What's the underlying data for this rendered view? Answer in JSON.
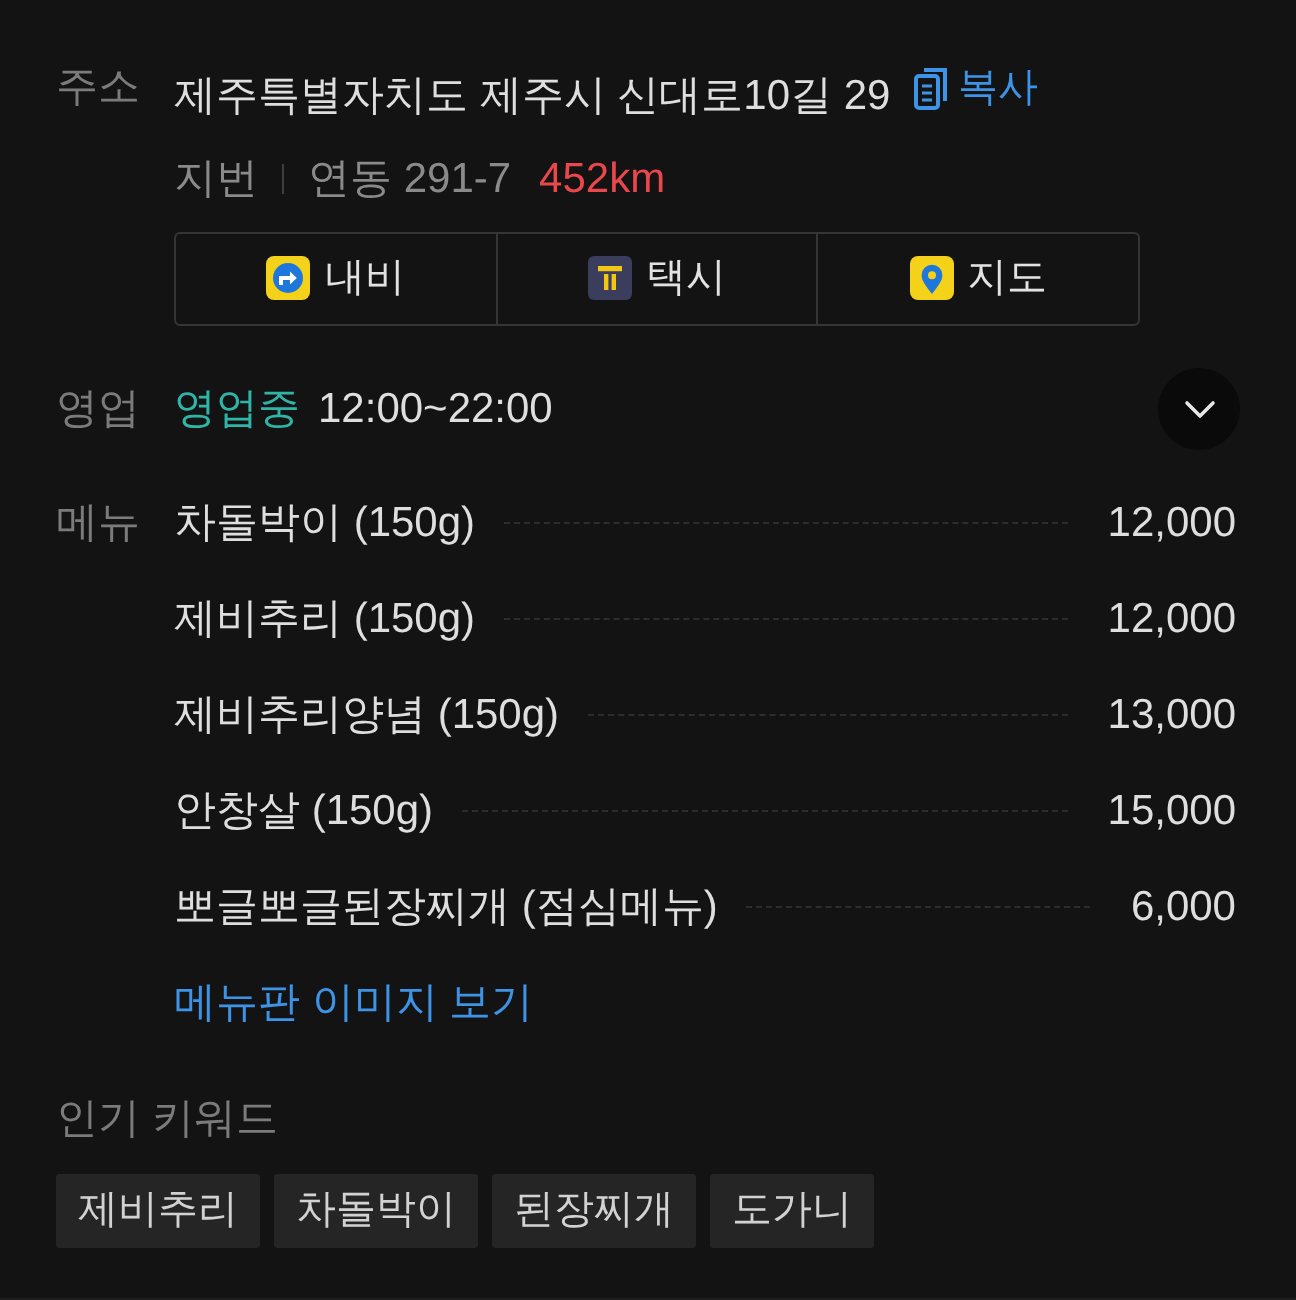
{
  "address": {
    "label": "주소",
    "road": "제주특별자치도 제주시 신대로10길 29",
    "copy_button": "복사",
    "lot_label": "지번",
    "lot": "연동 291-7",
    "distance": "452km"
  },
  "actions": [
    {
      "kind": "navi",
      "label": "내비"
    },
    {
      "kind": "taxi",
      "label": "택시"
    },
    {
      "kind": "map",
      "label": "지도"
    }
  ],
  "hours": {
    "label": "영업",
    "status": "영업중",
    "time": "12:00~22:00",
    "expanded": false
  },
  "menu": {
    "label": "메뉴",
    "items": [
      {
        "name": "차돌박이 (150g)",
        "price": "12,000"
      },
      {
        "name": "제비추리 (150g)",
        "price": "12,000"
      },
      {
        "name": "제비추리양념 (150g)",
        "price": "13,000"
      },
      {
        "name": "안창살 (150g)",
        "price": "15,000"
      },
      {
        "name": "뽀글뽀글된장찌개 (점심메뉴)",
        "price": "6,000"
      }
    ],
    "link": "메뉴판 이미지 보기"
  },
  "keywords": {
    "title": "인기 키워드",
    "tags": [
      "제비추리",
      "차돌박이",
      "된장찌개",
      "도가니"
    ]
  }
}
